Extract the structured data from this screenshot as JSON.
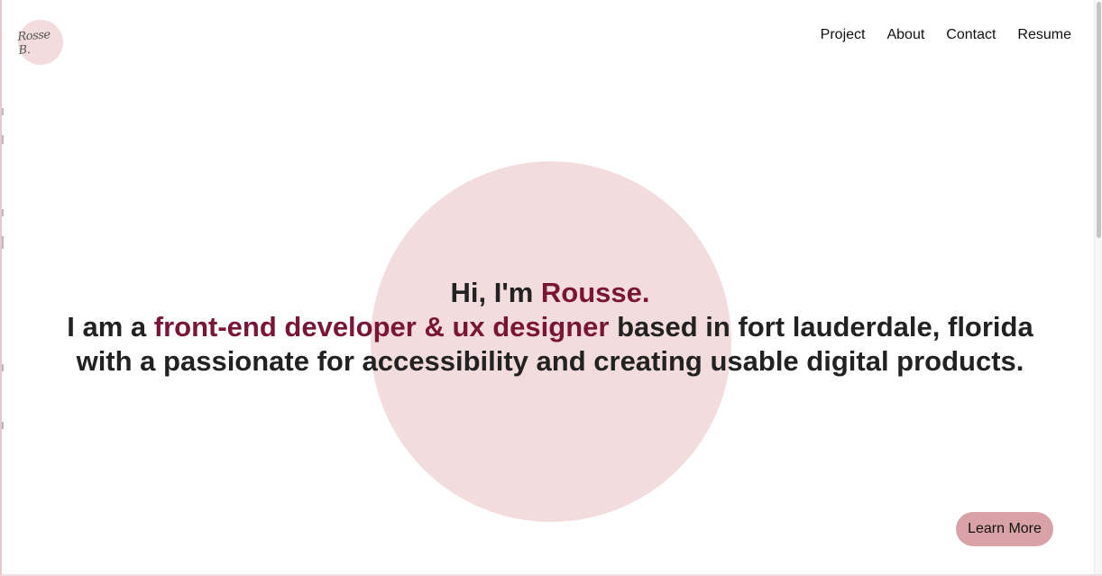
{
  "logo": {
    "text": "Rosse B."
  },
  "nav": {
    "items": [
      {
        "label": "Project"
      },
      {
        "label": "About"
      },
      {
        "label": "Contact"
      },
      {
        "label": "Resume"
      }
    ]
  },
  "hero": {
    "greeting_prefix": "Hi, I'm ",
    "name": "Rousse.",
    "intro_prefix": "I am a ",
    "role": "front-end developer & ux designer",
    "intro_suffix": " based in fort lauderdale, florida",
    "line3": "with a passionate for accessibility and creating usable digital products."
  },
  "cta": {
    "label": "Learn More"
  },
  "colors": {
    "accent": "#7a1535",
    "circle": "#f3dcde",
    "button": "#d9a2a6",
    "text": "#222222"
  }
}
